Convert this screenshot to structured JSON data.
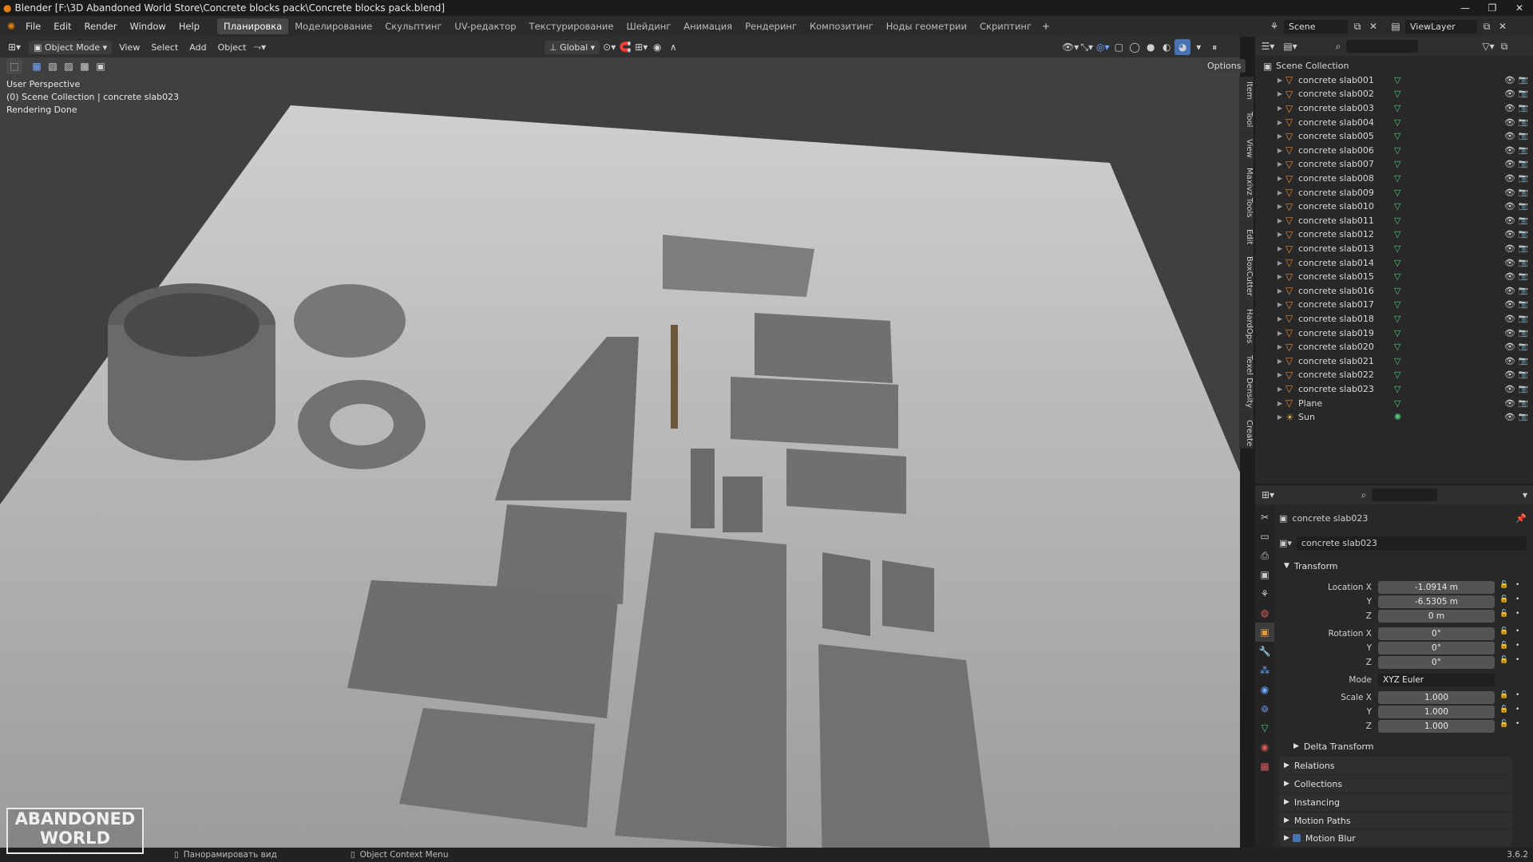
{
  "window": {
    "title": "Blender [F:\\3D Abandoned World Store\\Concrete blocks pack\\Concrete blocks pack.blend]"
  },
  "menu": {
    "items": [
      "File",
      "Edit",
      "Render",
      "Window",
      "Help"
    ],
    "workspaces": [
      "Планировка",
      "Моделирование",
      "Скульптинг",
      "UV-редактор",
      "Текстурирование",
      "Шейдинг",
      "Анимация",
      "Рендеринг",
      "Композитинг",
      "Ноды геометрии",
      "Скриптинг"
    ],
    "active_workspace": "Планировка",
    "scene": "Scene",
    "view_layer": "ViewLayer"
  },
  "viewport_header": {
    "mode": "Object Mode",
    "menus": [
      "View",
      "Select",
      "Add",
      "Object"
    ],
    "orientation": "Global",
    "options": "Options"
  },
  "viewport_info": {
    "line1": "User Perspective",
    "line2": "(0) Scene Collection | concrete slab023",
    "line3": "Rendering Done"
  },
  "side_tabs": [
    "Item",
    "Tool",
    "View",
    "Maxivz Tools",
    "Edit",
    "BoxCutter",
    "HardOps",
    "Texel Density",
    "Create"
  ],
  "outliner": {
    "root": "Scene Collection",
    "items": [
      {
        "name": "concrete slab001",
        "type": "mesh"
      },
      {
        "name": "concrete slab002",
        "type": "mesh"
      },
      {
        "name": "concrete slab003",
        "type": "mesh"
      },
      {
        "name": "concrete slab004",
        "type": "mesh"
      },
      {
        "name": "concrete slab005",
        "type": "mesh"
      },
      {
        "name": "concrete slab006",
        "type": "mesh"
      },
      {
        "name": "concrete slab007",
        "type": "mesh"
      },
      {
        "name": "concrete slab008",
        "type": "mesh"
      },
      {
        "name": "concrete slab009",
        "type": "mesh"
      },
      {
        "name": "concrete slab010",
        "type": "mesh"
      },
      {
        "name": "concrete slab011",
        "type": "mesh"
      },
      {
        "name": "concrete slab012",
        "type": "mesh"
      },
      {
        "name": "concrete slab013",
        "type": "mesh"
      },
      {
        "name": "concrete slab014",
        "type": "mesh"
      },
      {
        "name": "concrete slab015",
        "type": "mesh"
      },
      {
        "name": "concrete slab016",
        "type": "mesh"
      },
      {
        "name": "concrete slab017",
        "type": "mesh"
      },
      {
        "name": "concrete slab018",
        "type": "mesh"
      },
      {
        "name": "concrete slab019",
        "type": "mesh"
      },
      {
        "name": "concrete slab020",
        "type": "mesh"
      },
      {
        "name": "concrete slab021",
        "type": "mesh"
      },
      {
        "name": "concrete slab022",
        "type": "mesh"
      },
      {
        "name": "concrete slab023",
        "type": "mesh"
      },
      {
        "name": "Plane",
        "type": "mesh"
      },
      {
        "name": "Sun",
        "type": "light"
      }
    ]
  },
  "properties": {
    "object_name": "concrete slab023",
    "data_name": "concrete slab023",
    "transform_label": "Transform",
    "location_label": "Location X",
    "location": {
      "x": "-1.0914 m",
      "y": "-6.5305 m",
      "z": "0 m"
    },
    "rotation_label": "Rotation X",
    "rotation": {
      "x": "0°",
      "y": "0°",
      "z": "0°"
    },
    "mode_label": "Mode",
    "mode": "XYZ Euler",
    "scale_label": "Scale X",
    "scale": {
      "x": "1.000",
      "y": "1.000",
      "z": "1.000"
    },
    "axis_y": "Y",
    "axis_z": "Z",
    "sections": [
      "Delta Transform",
      "Relations",
      "Collections",
      "Instancing",
      "Motion Paths",
      "Motion Blur"
    ]
  },
  "statusbar": {
    "hint1": "Панорамировать вид",
    "hint2": "Object Context Menu",
    "version": "3.6.2"
  },
  "logo": {
    "line1": "ABANDONED",
    "line2": "WORLD"
  }
}
